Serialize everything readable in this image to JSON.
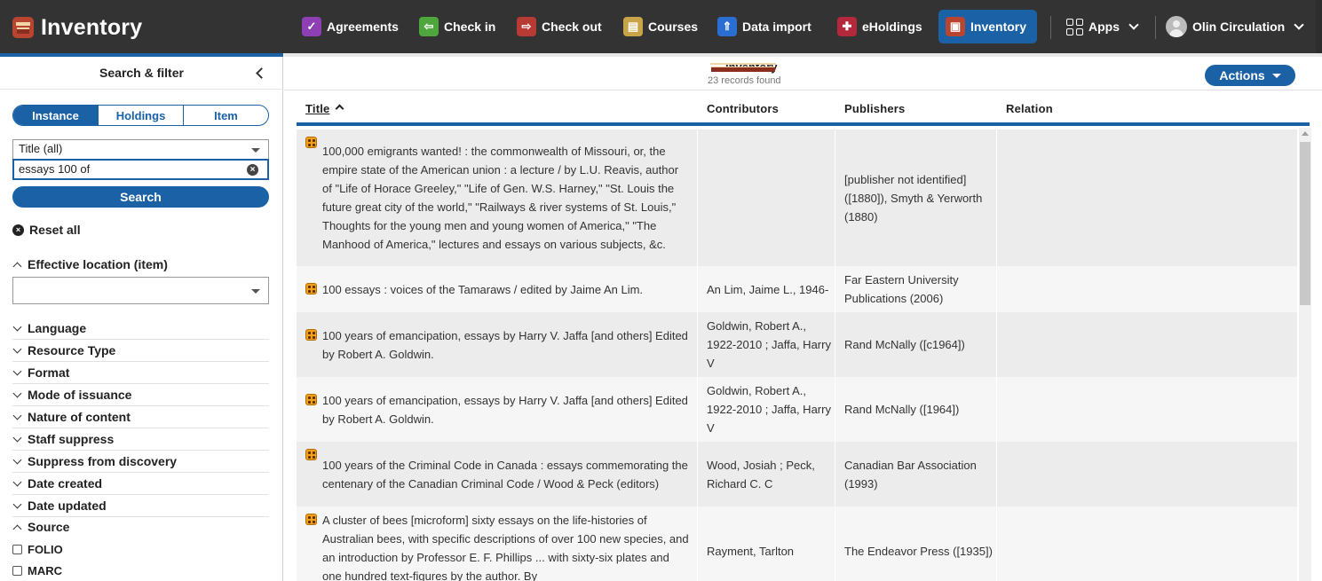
{
  "topbar": {
    "app_name": "Inventory",
    "nav": [
      {
        "label": "Agreements",
        "icon": "agreements-icon",
        "color": "#8e3fb3"
      },
      {
        "label": "Check in",
        "icon": "check-in-icon",
        "color": "#4ea63d"
      },
      {
        "label": "Check out",
        "icon": "check-out-icon",
        "color": "#b83a34"
      },
      {
        "label": "Courses",
        "icon": "courses-icon",
        "color": "#c7a447"
      },
      {
        "label": "Data import",
        "icon": "data-import-icon",
        "color": "#2b6ed1"
      },
      {
        "label": "eHoldings",
        "icon": "eholdings-icon",
        "color": "#b3283a"
      },
      {
        "label": "Inventory",
        "icon": "inventory-icon",
        "color": "#b9442f"
      }
    ],
    "apps_label": "Apps",
    "user_label": "Olin Circulation"
  },
  "left": {
    "title": "Search & filter",
    "segments": [
      "Instance",
      "Holdings",
      "Item"
    ],
    "field_select": "Title (all)",
    "search_value": "essays 100 of",
    "search_button": "Search",
    "reset_label": "Reset all",
    "effective_location": "Effective location (item)",
    "facets": [
      "Language",
      "Resource Type",
      "Format",
      "Mode of issuance",
      "Nature of content",
      "Staff suppress",
      "Suppress from discovery",
      "Date created",
      "Date updated"
    ],
    "source_label": "Source",
    "source_options": [
      "FOLIO",
      "MARC"
    ]
  },
  "results": {
    "title": "Inventory",
    "count": "23 records found",
    "actions_label": "Actions",
    "columns": [
      "Title",
      "Contributors",
      "Publishers",
      "Relation"
    ],
    "rows": [
      {
        "title": "100,000 emigrants wanted! : the commonwealth of Missouri, or, the empire state of the American union : a lecture / by L.U. Reavis, author of \"Life of Horace Greeley,\" \"Life of Gen. W.S. Harney,\" \"St. Louis the future great city of the world,\" \"Railways & river systems of St. Louis,\" Thoughts for the young men and young women of America,\" \"The Manhood of America,\" lectures and essays on various subjects, &c.",
        "contributors": "",
        "publishers": "[publisher not identified] ([1880]), Smyth & Yerworth (1880)",
        "relation": ""
      },
      {
        "title": "100 essays : voices of the Tamaraws / edited by Jaime An Lim.",
        "contributors": "An Lim, Jaime L., 1946-",
        "publishers": "Far Eastern University Publications (2006)",
        "relation": ""
      },
      {
        "title": "100 years of emancipation, essays by Harry V. Jaffa [and others] Edited by Robert A. Goldwin.",
        "contributors": "Goldwin, Robert A., 1922-2010 ; Jaffa, Harry V",
        "publishers": "Rand McNally ([c1964])",
        "relation": ""
      },
      {
        "title": "100 years of emancipation, essays by Harry V. Jaffa [and others] Edited by Robert A. Goldwin.",
        "contributors": "Goldwin, Robert A., 1922-2010 ; Jaffa, Harry V",
        "publishers": "Rand McNally ([1964])",
        "relation": ""
      },
      {
        "title": "100 years of the Criminal Code in Canada : essays commemorating the centenary of the Canadian Criminal Code / Wood & Peck (editors)",
        "contributors": "Wood, Josiah ; Peck, Richard C. C",
        "publishers": "Canadian Bar Association (1993)",
        "relation": ""
      },
      {
        "title": "A cluster of bees [microform] sixty essays on the life-histories of Australian bees, with specific descriptions of over 100 new species, and an introduction by Professor E. F. Phillips ... with sixty-six plates and one hundred text-figures by the author. By",
        "contributors": "Rayment, Tarlton",
        "publishers": "The Endeavor Press ([1935])",
        "relation": ""
      }
    ]
  }
}
